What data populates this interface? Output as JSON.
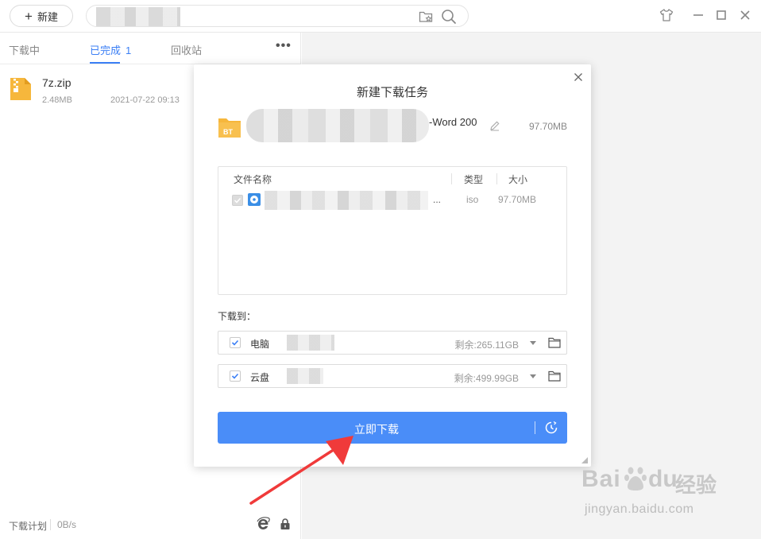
{
  "titlebar": {
    "new_label": "新建"
  },
  "tabs": [
    {
      "label": "下载中"
    },
    {
      "label": "已完成",
      "count": "1"
    },
    {
      "label": "回收站"
    }
  ],
  "more": "•••",
  "files": [
    {
      "name": "7z.zip",
      "size": "2.48MB",
      "date": "2021-07-22 09:13"
    }
  ],
  "footer": {
    "plan": "下载计划",
    "speed": "0B/s"
  },
  "dialog": {
    "title": "新建下载任务",
    "task_name_suffix": "-Word 200",
    "task_size": "97.70MB",
    "table": {
      "col_name": "文件名称",
      "col_type": "类型",
      "col_size": "大小",
      "rows": [
        {
          "name_suffix": "...",
          "type": "iso",
          "size": "97.70MB"
        }
      ]
    },
    "download_to": "下载到：",
    "destinations": [
      {
        "name": "电脑",
        "free": "剩余:265.11GB"
      },
      {
        "name": "云盘",
        "free": "剩余:499.99GB"
      }
    ],
    "download_button": "立即下载"
  },
  "watermark": {
    "brand": "Bai",
    "brand2": "du",
    "suffix": "经验",
    "url": "jingyan.baidu.com"
  },
  "colors": {
    "accent": "#3b7ff5",
    "button": "#4a8df8",
    "folder": "#f6b73c",
    "arrow": "#f03a3a"
  }
}
